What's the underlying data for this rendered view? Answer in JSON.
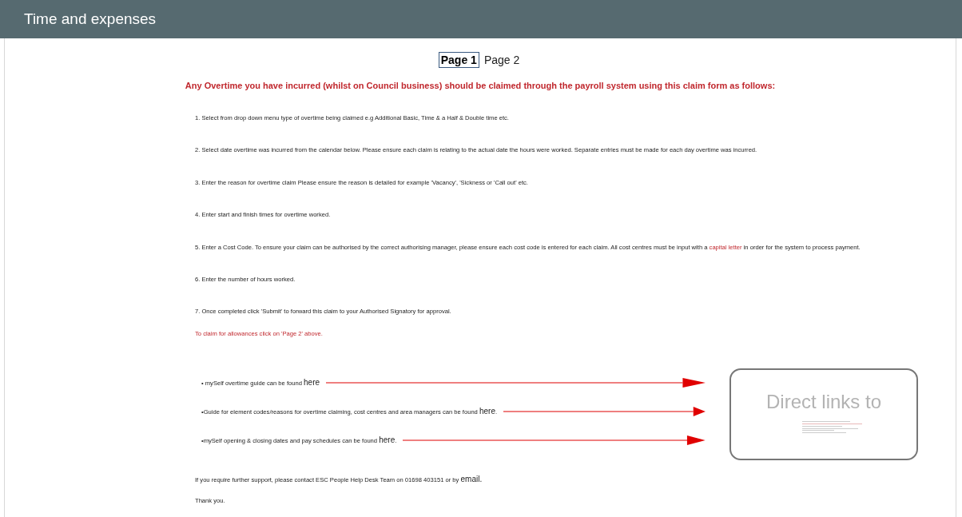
{
  "header": {
    "title": "Time and expenses"
  },
  "pager": [
    {
      "label": "Page 1",
      "selected": true
    },
    {
      "label": "Page 2",
      "selected": false
    }
  ],
  "notice": "Any Overtime you have incurred (whilst on Council business) should be claimed through the payroll system using this claim form as follows:",
  "steps": [
    {
      "parts": [
        {
          "kind": "plain",
          "text": "1. Select from drop down menu type of overtime being claimed e.g Additional Basic, Time & a Half & Double time etc."
        }
      ]
    },
    {
      "parts": [
        {
          "kind": "plain",
          "text": "2. Select date overtime was incurred from the calendar below. Please ensure each claim is relating to the actual date the hours were worked. Separate entries must be made for each day overtime was incurred."
        }
      ]
    },
    {
      "parts": [
        {
          "kind": "plain",
          "text": "3. Enter the reason for overtime claim Please ensure the reason is detailed for example 'Vacancy', 'Sickness or 'Call out' etc."
        }
      ]
    },
    {
      "parts": [
        {
          "kind": "plain",
          "text": "4. Enter start and finish times for overtime worked."
        }
      ]
    },
    {
      "parts": [
        {
          "kind": "plain",
          "text": "5. Enter a Cost Code. To ensure your claim can be authorised by the correct authorising manager, please ensure each cost code is entered for each claim. All cost centres must be input with a "
        },
        {
          "kind": "highlight",
          "text": "capital letter"
        },
        {
          "kind": "plain",
          "text": " in order for the system to process payment."
        }
      ]
    },
    {
      "parts": [
        {
          "kind": "plain",
          "text": "6. Enter the number of hours worked."
        }
      ]
    },
    {
      "parts": [
        {
          "kind": "plain",
          "text": "7. Once completed click 'Submit' to forward this claim to your Authorised Signatory for approval."
        }
      ]
    }
  ],
  "allowances_note": "To claim for allowances click on 'Page 2' above.",
  "links": [
    {
      "text": "• mySelf overtime guide can be found ",
      "link": "here"
    },
    {
      "text": "•Guide for element codes/reasons for overtime claiming, cost centres and area managers can be found ",
      "link": "here",
      "after": "."
    },
    {
      "text": "•mySelf opening & closing dates and pay schedules can be found ",
      "link": "here",
      "after": "."
    }
  ],
  "support": {
    "text": "If you require further support, please contact ESC People Help Desk Team on 01698 403151 or by ",
    "link": "email."
  },
  "thanks": "Thank you.",
  "callout": {
    "title": "Direct links to"
  }
}
